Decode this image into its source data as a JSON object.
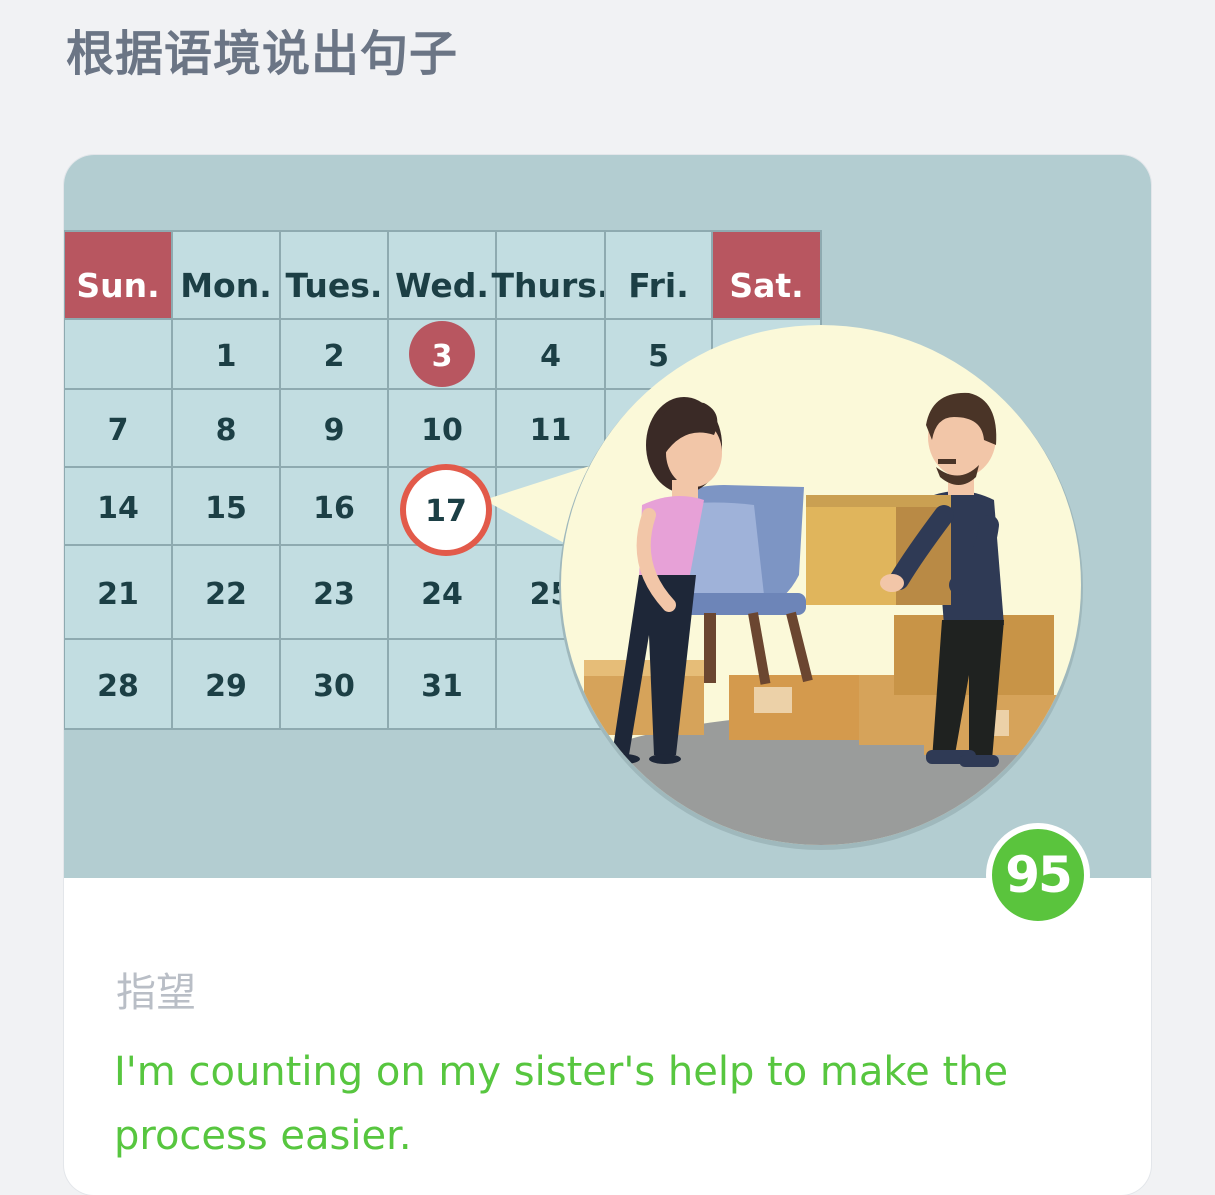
{
  "page": {
    "title": "根据语境说出句子"
  },
  "calendar": {
    "weekdays": [
      "Sun.",
      "Mon.",
      "Tues.",
      "Wed.",
      "Thurs.",
      "Fri.",
      "Sat."
    ],
    "rows": [
      [
        "",
        "1",
        "2",
        "3",
        "4",
        "5",
        ""
      ],
      [
        "7",
        "8",
        "9",
        "10",
        "11",
        "",
        ""
      ],
      [
        "14",
        "15",
        "16",
        "17",
        "",
        "",
        ""
      ],
      [
        "21",
        "22",
        "23",
        "24",
        "25",
        "",
        ""
      ],
      [
        "28",
        "29",
        "30",
        "31",
        "",
        "",
        ""
      ]
    ],
    "highlighted_today": "3",
    "circled_date": "17",
    "weekend_color": "#b85660",
    "cell_color": "#c2dde1"
  },
  "score": {
    "value": "95",
    "color": "#5ac43d"
  },
  "card": {
    "keyword": "指望",
    "sentence": "I'm counting on my sister's help to make the process easier.",
    "sentence_color": "#57c63f"
  }
}
